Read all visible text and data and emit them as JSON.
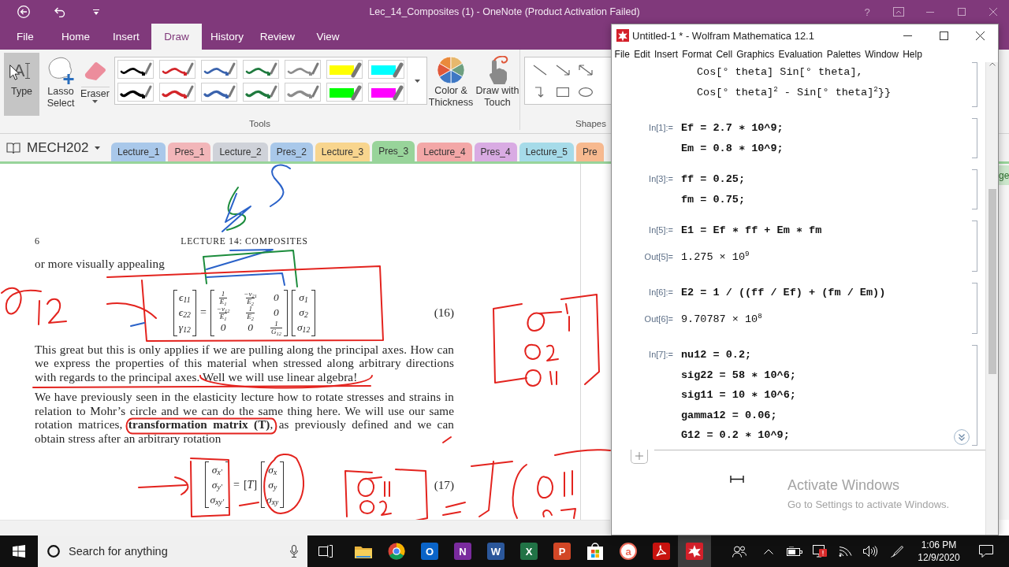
{
  "onenote": {
    "title_bar": {
      "title": "Lec_14_Composites (1) - OneNote (Product Activation Failed)",
      "help": "?"
    },
    "ribbon_tabs": [
      {
        "label": "File",
        "selected": false
      },
      {
        "label": "Home",
        "selected": false
      },
      {
        "label": "Insert",
        "selected": false
      },
      {
        "label": "Draw",
        "selected": true
      },
      {
        "label": "History",
        "selected": false
      },
      {
        "label": "Review",
        "selected": false
      },
      {
        "label": "View",
        "selected": false
      }
    ],
    "tools": [
      {
        "kind": "type",
        "glyph": "A",
        "label": "Type",
        "selected": true
      },
      {
        "kind": "lasso",
        "label": "Lasso Select",
        "selected": false
      },
      {
        "kind": "eraser",
        "label": "Eraser",
        "selected": false
      }
    ],
    "pens": [
      {
        "kind": "thin",
        "color": "#000000",
        "selected": false
      },
      {
        "kind": "thin",
        "color": "#d3252a",
        "selected": false
      },
      {
        "kind": "thin",
        "color": "#3a63ad",
        "selected": false
      },
      {
        "kind": "thin",
        "color": "#1f7a3e",
        "selected": false
      },
      {
        "kind": "thin",
        "color": "#8c8c8c",
        "selected": false
      },
      {
        "kind": "highlighter",
        "color": "#ffff00",
        "selected": false
      },
      {
        "kind": "highlighter",
        "color": "#00ffff",
        "selected": false
      },
      {
        "kind": "thick",
        "color": "#000000",
        "selected": false
      },
      {
        "kind": "thick",
        "color": "#d3252a",
        "selected": false
      },
      {
        "kind": "thick",
        "color": "#3a63ad",
        "selected": false
      },
      {
        "kind": "thick",
        "color": "#1f7a3e",
        "selected": false
      },
      {
        "kind": "thick",
        "color": "#8c8c8c",
        "selected": false
      },
      {
        "kind": "highlighter",
        "color": "#00ff00",
        "selected": false
      },
      {
        "kind": "highlighter",
        "color": "#ff00ff",
        "selected": false
      }
    ],
    "actions": [
      {
        "kind": "color",
        "label": "Color & Thickness"
      },
      {
        "kind": "touch",
        "label": "Draw with Touch"
      }
    ],
    "tools_label": "Tools",
    "shapes": {
      "label": "Shapes",
      "items": [
        {
          "kind": "line"
        },
        {
          "kind": "arrow"
        },
        {
          "kind": "double-arrow"
        },
        {
          "kind": "elbow"
        },
        {
          "kind": "rectangle"
        },
        {
          "kind": "ellipse"
        }
      ]
    },
    "notebook": {
      "name": "MECH202",
      "sections": [
        {
          "label": "Lecture_1",
          "color": "#a9c8ea",
          "selected": false
        },
        {
          "label": "Pres_1",
          "color": "#f2b6b9",
          "selected": false
        },
        {
          "label": "Lecture_2",
          "color": "#cfd2d9",
          "selected": false
        },
        {
          "label": "Pres_2",
          "color": "#a9c8ea",
          "selected": false
        },
        {
          "label": "Lecture_3",
          "color": "#f8d58e",
          "selected": false
        },
        {
          "label": "Pres_3",
          "color": "#98d49a",
          "selected": true
        },
        {
          "label": "Lecture_4",
          "color": "#f3a7a7",
          "selected": false
        },
        {
          "label": "Pres_4",
          "color": "#d9abe3",
          "selected": false
        },
        {
          "label": "Lecture_5",
          "color": "#a6dbe9",
          "selected": false
        },
        {
          "label": "Pre",
          "color": "#f7b98f",
          "selected": false
        }
      ]
    },
    "page": {
      "number": "6",
      "header": "LECTURE 14: COMPOSITES",
      "blocks": [
        {
          "kind": "text",
          "text": "or more visually appealing"
        },
        {
          "kind": "equation",
          "label": "(16)",
          "terms": [
            {
              "kind": "matrix",
              "rows": [
                [
                  {
                    "kind": "text",
                    "text": "ϵ$_{11}$"
                  }
                ],
                [
                  {
                    "kind": "text",
                    "text": "ϵ$_{22}$"
                  }
                ],
                [
                  {
                    "kind": "text",
                    "text": "γ$_{12}$"
                  }
                ]
              ]
            },
            {
              "kind": "symbol",
              "text": "="
            },
            {
              "kind": "matrix",
              "rows": [
                [
                  {
                    "kind": "frac",
                    "num": "1",
                    "den": "E$_{1}$"
                  },
                  {
                    "kind": "frac",
                    "num": "−ν$_{21}$",
                    "den": "E$_{2}$"
                  },
                  {
                    "kind": "text",
                    "text": "0"
                  }
                ],
                [
                  {
                    "kind": "frac",
                    "num": "−ν$_{12}$",
                    "den": "E$_{1}$"
                  },
                  {
                    "kind": "frac",
                    "num": "1",
                    "den": "E$_{2}$"
                  },
                  {
                    "kind": "text",
                    "text": "0"
                  }
                ],
                [
                  {
                    "kind": "text",
                    "text": "0"
                  },
                  {
                    "kind": "text",
                    "text": "0"
                  },
                  {
                    "kind": "frac",
                    "num": "1",
                    "den": "G$_{12}$"
                  }
                ]
              ]
            },
            {
              "kind": "matrix",
              "rows": [
                [
                  {
                    "kind": "text",
                    "text": "σ$_{1}$"
                  }
                ],
                [
                  {
                    "kind": "text",
                    "text": "σ$_{2}$"
                  }
                ],
                [
                  {
                    "kind": "text",
                    "text": "σ$_{12}$"
                  }
                ]
              ]
            }
          ]
        },
        {
          "kind": "text",
          "text": "This great but this is only applies if we are pulling along the principal axes. How can we express the properties of this material when stressed along arbitrary directions with regards to the principal axes. Well we will use linear algebra!"
        },
        {
          "kind": "text",
          "text": "We have previously seen in the elasticity lecture how to rotate stresses and strains in relation to Mohr’s circle and we can do the same thing here. We will use our same rotation matrices, **transformation matrix (T)**, as previously defined and we can obtain stress after an arbitrary rotation"
        },
        {
          "kind": "equation",
          "label": "(17)",
          "terms": [
            {
              "kind": "matrix",
              "rows": [
                [
                  {
                    "kind": "text",
                    "text": "σ$_{x′}$"
                  }
                ],
                [
                  {
                    "kind": "text",
                    "text": "σ$_{y′}$"
                  }
                ],
                [
                  {
                    "kind": "text",
                    "text": "σ$_{xy′}$"
                  }
                ]
              ]
            },
            {
              "kind": "symbol",
              "text": "="
            },
            {
              "kind": "symbol",
              "text": "[*T*]"
            },
            {
              "kind": "matrix",
              "rows": [
                [
                  {
                    "kind": "text",
                    "text": "σ$_{x}$"
                  }
                ],
                [
                  {
                    "kind": "text",
                    "text": "σ$_{y}$"
                  }
                ],
                [
                  {
                    "kind": "text",
                    "text": "σ$_{xy}$"
                  }
                ]
              ]
            }
          ]
        }
      ]
    },
    "pages_pane": {
      "button": "ge"
    }
  },
  "mathematica": {
    "title": "Untitled-1 * - Wolfram Mathematica 12.1",
    "menu": [
      "File",
      "Edit",
      "Insert",
      "Format",
      "Cell",
      "Graphics",
      "Evaluation",
      "Palettes",
      "Window",
      "Help"
    ],
    "groups": [
      {
        "cells": [
          {
            "kind": "continuation",
            "lines": [
              "Cos[° theta] Sin[° theta],",
              "Cos[° theta]$^{2}$ - Sin[° theta]$^{2}$}}"
            ]
          }
        ]
      },
      {
        "cells": [
          {
            "kind": "input",
            "label": "In[1]:=",
            "lines": [
              "Ef = 2.7 ∗ 10^9;",
              "Em = 0.8 ∗ 10^9;"
            ]
          }
        ]
      },
      {
        "cells": [
          {
            "kind": "input",
            "label": "In[3]:=",
            "lines": [
              "ff = 0.25;",
              "fm = 0.75;"
            ]
          }
        ]
      },
      {
        "cells": [
          {
            "kind": "input",
            "label": "In[5]:=",
            "lines": [
              "E1 = Ef ∗ ff + Em ∗ fm"
            ]
          },
          {
            "kind": "output",
            "label": "Out[5]=",
            "lines": [
              "1.275 × 10$^{9}$"
            ]
          }
        ]
      },
      {
        "cells": [
          {
            "kind": "input",
            "label": "In[6]:=",
            "lines": [
              "E2 = 1 / ((ff / Ef) + (fm / Em))"
            ]
          },
          {
            "kind": "output",
            "label": "Out[6]=",
            "lines": [
              "9.70787 × 10$^{8}$"
            ]
          }
        ]
      },
      {
        "cells": [
          {
            "kind": "input",
            "label": "In[7]:=",
            "lines": [
              "nu12 = 0.2;",
              "sig22 = 58 ∗ 10^6;",
              "sig11 = 10 ∗ 10^6;",
              "gamma12 = 0.06;",
              "G12 = 0.2 ∗ 10^9;"
            ]
          }
        ]
      }
    ],
    "activation": {
      "title": "Activate Windows",
      "hint": "Go to Settings to activate Windows."
    }
  },
  "taskbar": {
    "search": {
      "placeholder": "Search for anything"
    },
    "apps": [
      {
        "kind": "folder",
        "active": false
      },
      {
        "kind": "globe",
        "active": false
      },
      {
        "kind": "tile",
        "glyph": "O",
        "color": "#0a64c8",
        "active": false
      },
      {
        "kind": "tile",
        "glyph": "N",
        "color": "#7a2b9e",
        "active": false
      },
      {
        "kind": "tile",
        "glyph": "W",
        "color": "#2b579a",
        "active": false
      },
      {
        "kind": "tile",
        "glyph": "X",
        "color": "#217346",
        "active": false
      },
      {
        "kind": "tile",
        "glyph": "P",
        "color": "#d24726",
        "active": false
      },
      {
        "kind": "bag",
        "active": false
      },
      {
        "kind": "disc",
        "glyph": "a",
        "color": "#ee6b5b",
        "active": false
      },
      {
        "kind": "pdf",
        "active": false
      },
      {
        "kind": "spikey",
        "active": true
      }
    ],
    "clock": {
      "time": "1:06 PM",
      "date": "12/9/2020"
    }
  }
}
